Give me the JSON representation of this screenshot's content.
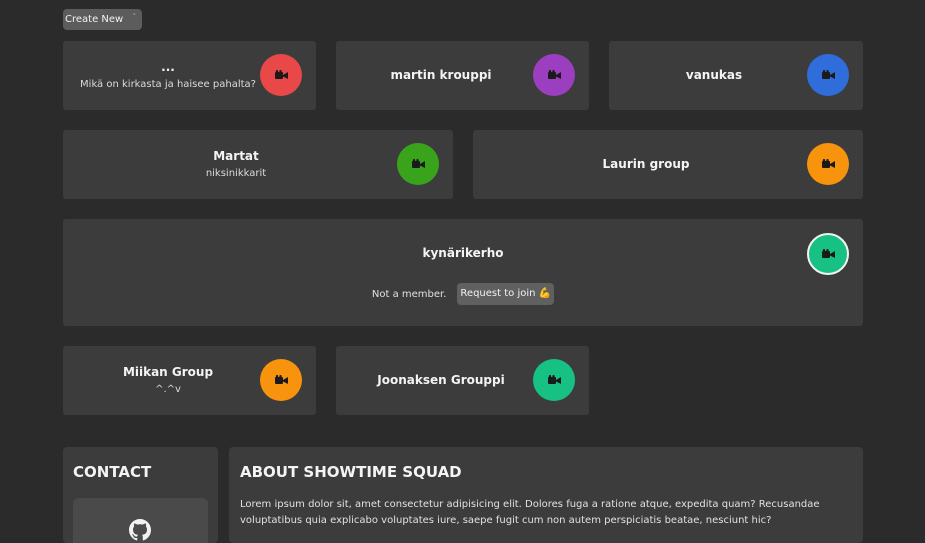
{
  "toolbar": {
    "create_label": "Create New",
    "create_caret": "˅"
  },
  "groups": [
    {
      "title": "...",
      "subtitle": "Mikä on kirkasta ja haisee pahalta?",
      "avatar_color": "#e84848",
      "icon": "video-camera-icon"
    },
    {
      "title": "martin krouppi",
      "subtitle": "",
      "avatar_color": "#9b3fc0",
      "icon": "video-camera-icon"
    },
    {
      "title": "vanukas",
      "subtitle": "",
      "avatar_color": "#2f6ddb",
      "icon": "video-camera-icon"
    },
    {
      "title": "Martat",
      "subtitle": "niksinikkarit",
      "avatar_color": "#3aa31c",
      "icon": "video-camera-icon"
    },
    {
      "title": "Laurin group",
      "subtitle": "",
      "avatar_color": "#f7930c",
      "icon": "video-camera-icon"
    },
    {
      "title": "kynärikerho",
      "subtitle": "",
      "avatar_color": "#17c183",
      "icon": "video-camera-icon",
      "membership_text": "Not a member.",
      "join_label": "Request to join 💪"
    },
    {
      "title": "Miikan Group",
      "subtitle": "^.^v",
      "avatar_color": "#f7930c",
      "icon": "video-camera-icon"
    },
    {
      "title": "Joonaksen Grouppi",
      "subtitle": "",
      "avatar_color": "#17c183",
      "icon": "video-camera-icon"
    }
  ],
  "contact": {
    "heading": "CONTACT",
    "icon": "github-icon"
  },
  "about": {
    "heading": "ABOUT SHOWTIME SQUAD",
    "body": "Lorem ipsum dolor sit, amet consectetur adipisicing elit. Dolores fuga a ratione atque, expedita quam? Recusandae voluptatibus quia explicabo voluptates iure, saepe fugit cum non autem perspiciatis beatae, nesciunt hic?"
  }
}
